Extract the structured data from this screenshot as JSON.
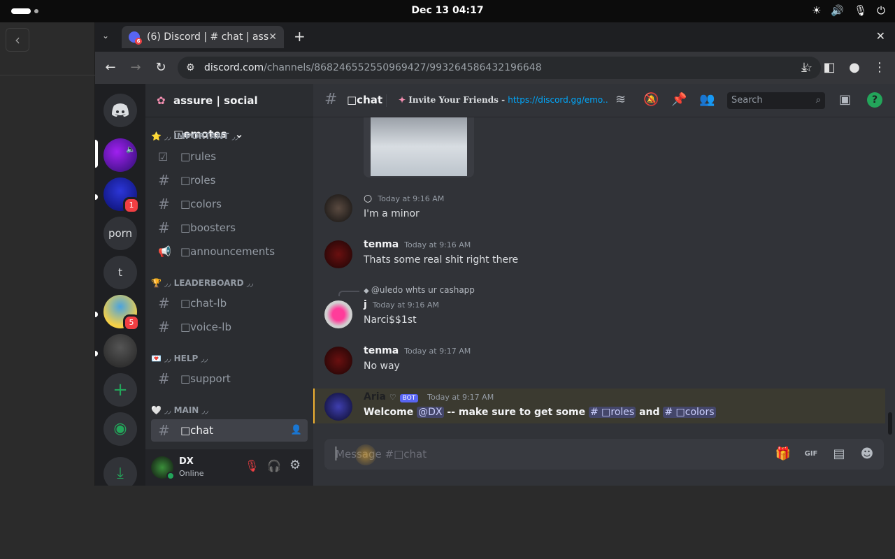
{
  "system": {
    "clock": "Dec 13  04:17"
  },
  "browser": {
    "tab_title": "(6) Discord | # chat | ass",
    "tab_badge": "6",
    "url_host": "discord.com",
    "url_path": "/channels/868246552550969427/993264586432196648"
  },
  "guilds": [
    {
      "label": "",
      "badge": ""
    },
    {
      "label": "",
      "badge": "1"
    },
    {
      "label": "porn",
      "badge": ""
    },
    {
      "label": "t",
      "badge": ""
    },
    {
      "label": "",
      "badge": "5"
    },
    {
      "label": "",
      "badge": ""
    }
  ],
  "server": {
    "name": "assure | social □emotes",
    "categories": [
      {
        "label": "⭐ ⼀⼀ IMPORTANT ⼀⼀",
        "display": "⭐ ◞◞ IMPORTANT ◞◞"
      },
      {
        "label": "🏆 ◞◞ LEADERBOARD ◞◞",
        "display": "🏆 ◞◞ LEADERBOARD ◞◞"
      },
      {
        "label": "💌 ◞◞ HELP ◞◞",
        "display": "💌 ◞◞ HELP ◞◞"
      },
      {
        "label": "🤍 ◞◞ MAIN ◞◞",
        "display": "🤍 ◞◞ MAIN ◞◞"
      }
    ],
    "channels": [
      "□rules",
      "□roles",
      "□colors",
      "□boosters",
      "□announcements",
      "□chat-lb",
      "□voice-lb",
      "□support",
      "□chat"
    ]
  },
  "user": {
    "name": "DX",
    "status": "Online"
  },
  "channel": {
    "name": "□chat",
    "topic_prefix": "Invite Your Friends - ",
    "topic_link": "https://discord.gg/emo...",
    "search_placeholder": "Search",
    "composer_placeholder": "Message #□chat"
  },
  "messages": [
    {
      "author": "○",
      "time": "Today at 9:16 AM",
      "text": "I'm a minor"
    },
    {
      "author": "tenma",
      "time": "Today at 9:16 AM",
      "text": "Thats some real shit right there"
    },
    {
      "author": "j",
      "time": "Today at 9:16 AM",
      "text": "Narci$$1st",
      "reply": "@uledo whts ur cashapp"
    },
    {
      "author": "tenma",
      "time": "Today at 9:17 AM",
      "text": "No way"
    },
    {
      "author": "Aria",
      "time": "Today at 9:17 AM",
      "bot": "BOT",
      "welcome_a": "Welcome",
      "mention_user": "@DX",
      "welcome_b": "-- make sure to get some",
      "mention_roles": "# □roles",
      "welcome_and": "and",
      "mention_colors": "# □colors"
    }
  ],
  "colors": {
    "accent": "#5865f2",
    "online": "#23a55a",
    "danger": "#f23f43"
  }
}
